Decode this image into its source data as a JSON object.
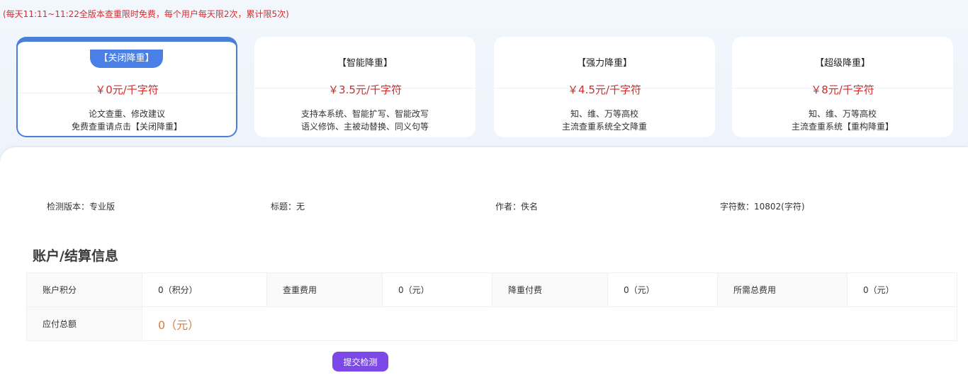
{
  "notice": "(每天11:11~11:22全版本查重限时免费，每个用户每天限2次，累计限5次)",
  "plans": [
    {
      "name": "【关闭降重】",
      "price": "￥0元/千字符",
      "desc1": "论文查重、修改建议",
      "desc2": "免费查重请点击【关闭降重】"
    },
    {
      "name": "【智能降重】",
      "price": "￥3.5元/千字符",
      "desc1": "支持本系统、智能扩写、智能改写",
      "desc2": "语义修饰、主被动替换、同义句等"
    },
    {
      "name": "【强力降重】",
      "price": "￥4.5元/千字符",
      "desc1": "知、维、万等高校",
      "desc2": "主流查重系统全文降重"
    },
    {
      "name": "【超级降重】",
      "price": "￥8元/千字符",
      "desc1": "知、维、万等高校",
      "desc2": "主流查重系统【重构降重】"
    }
  ],
  "meta": {
    "version": "检测版本：专业版",
    "title": "标题：无",
    "author": "作者：佚名",
    "chars": "字符数：10802(字符)"
  },
  "account": {
    "section_title": "账户/结算信息",
    "points_label": "账户积分",
    "points_value": "0（积分）",
    "check_fee_label": "查重费用",
    "check_fee_value": "0（元）",
    "reduce_fee_label": "降重付费",
    "reduce_fee_value": "0（元）",
    "total_fee_label": "所需总费用",
    "total_fee_value": "0（元）",
    "payable_label": "应付总额",
    "payable_value": "0（元）"
  },
  "submit_label": "提交检测",
  "colors": {
    "accent_blue": "#4a7fe6",
    "price_red": "#d12b2b",
    "payable_orange": "#e07a3c",
    "submit_purple": "#7d48e8"
  }
}
